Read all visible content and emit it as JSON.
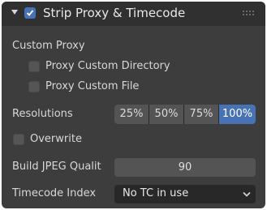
{
  "panel": {
    "title": "Strip Proxy & Timecode",
    "enabled": true
  },
  "custom_proxy": {
    "label": "Custom Proxy",
    "directory_label": "Proxy Custom Directory",
    "file_label": "Proxy Custom File"
  },
  "resolutions": {
    "label": "Resolutions",
    "options": [
      "25%",
      "50%",
      "75%",
      "100%"
    ],
    "selected": "100%"
  },
  "overwrite": {
    "label": "Overwrite"
  },
  "jpeg_quality": {
    "label": "Build JPEG Qualit",
    "value": "90"
  },
  "timecode_index": {
    "label": "Timecode Index",
    "value": "No TC in use"
  },
  "colors": {
    "panel_bg": "#3d3d3d",
    "header_bg": "#303030",
    "accent": "#4772b3",
    "field_bg": "#545454",
    "dark_field_bg": "#282828"
  },
  "icons": {
    "collapse": "triangle-down-icon",
    "checkmark": "checkmark-icon",
    "drag": "grip-icon",
    "dropdown": "chevron-down-icon"
  }
}
